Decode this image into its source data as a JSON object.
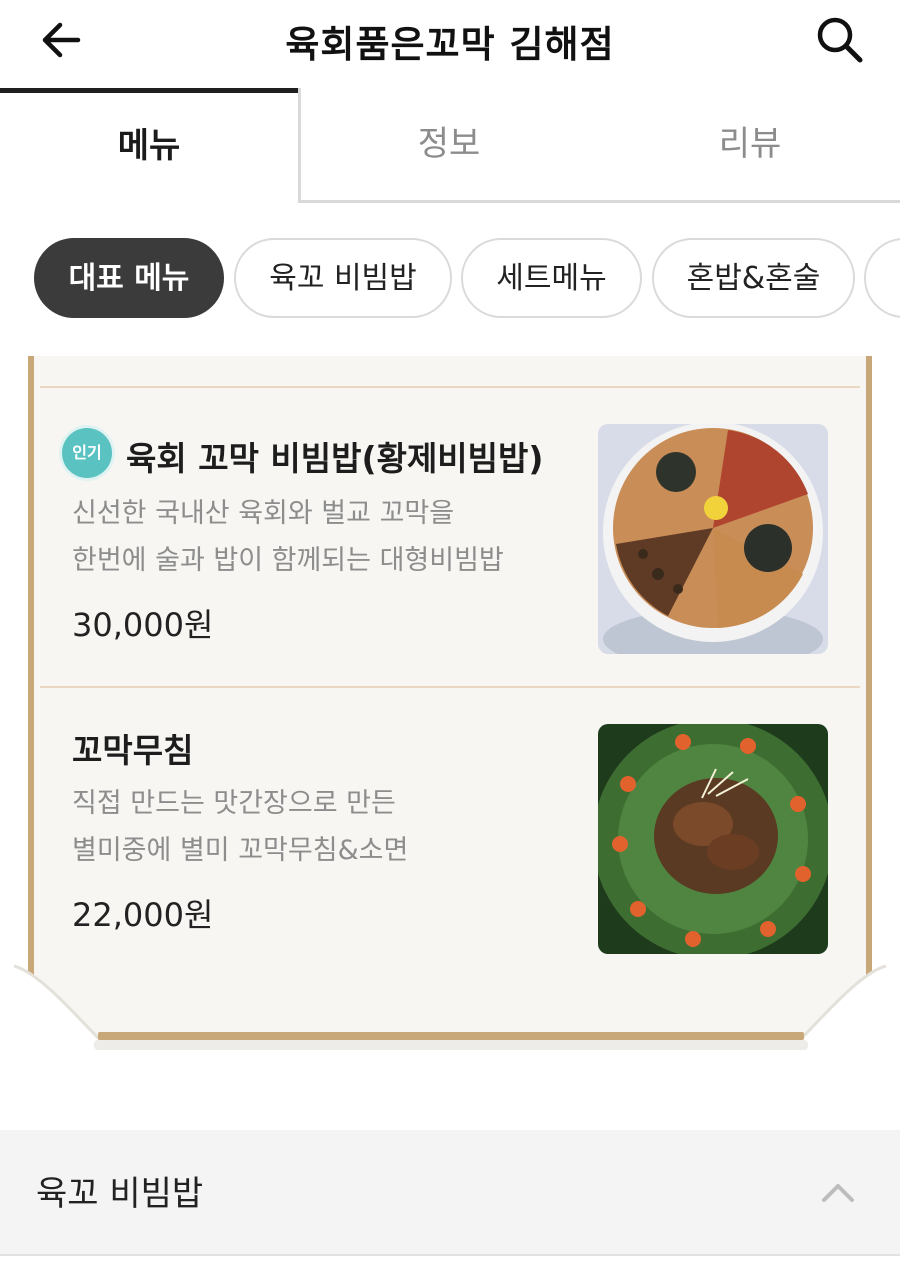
{
  "header": {
    "title": "육회품은꼬막 김해점",
    "back_icon": "arrow-left-icon",
    "search_icon": "search-icon"
  },
  "tabs": [
    {
      "label": "메뉴",
      "active": true
    },
    {
      "label": "정보",
      "active": false
    },
    {
      "label": "리뷰",
      "active": false
    }
  ],
  "categories": [
    {
      "label": "대표 메뉴",
      "active": true
    },
    {
      "label": "육꼬 비빔밥",
      "active": false
    },
    {
      "label": "세트메뉴",
      "active": false
    },
    {
      "label": "혼밥&혼술",
      "active": false
    }
  ],
  "menu_items": [
    {
      "badge": "인기",
      "name": "육회 꼬막 비빔밥(황제비빔밥)",
      "description": [
        "신선한 국내산 육회와 벌교 꼬막을",
        "한번에 술과 밥이 함께되는 대형비빔밥"
      ],
      "price": "30,000원"
    },
    {
      "name": "꼬막무침",
      "description": [
        "직접 만드는 맛간장으로 만든",
        "별미중에 별미 꼬막무침&소면"
      ],
      "price": "22,000원"
    }
  ],
  "section": {
    "title": "육꼬 비빔밥",
    "icon": "chevron-up-icon"
  },
  "colors": {
    "accent_dark": "#3b3b3b",
    "paper_border": "#c8a878",
    "badge": "#5ac2c0"
  }
}
